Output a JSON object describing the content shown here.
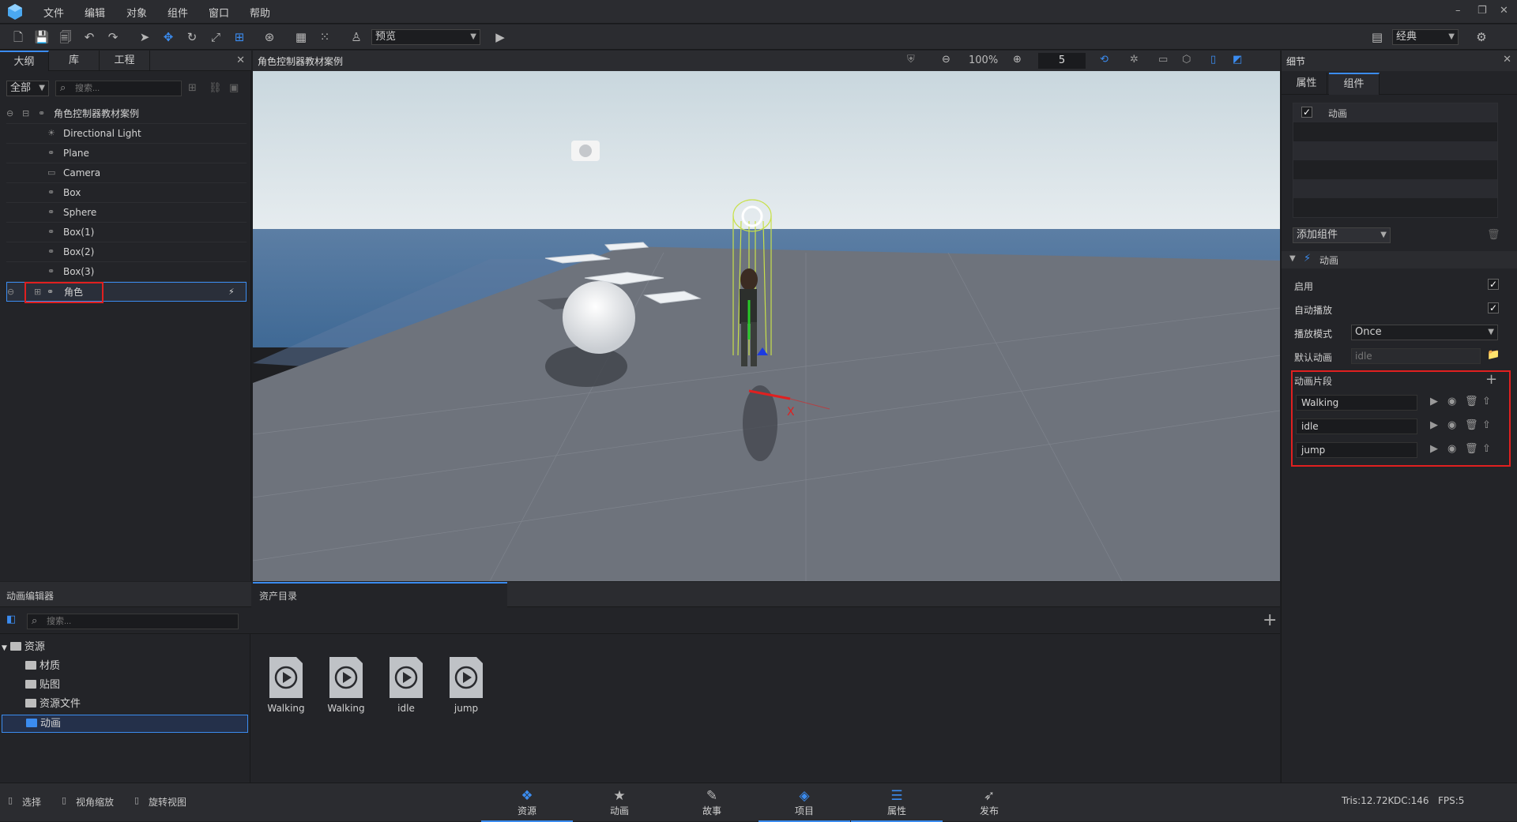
{
  "menu": [
    "文件",
    "编辑",
    "对象",
    "组件",
    "窗口",
    "帮助"
  ],
  "toolbar": {
    "preview_label": "预览",
    "layout_label": "经典"
  },
  "left": {
    "tabs": [
      "大纲",
      "库",
      "工程"
    ],
    "filter": "全部",
    "search_placeholder": "搜索...",
    "tree": [
      {
        "label": "角色控制器教材案例"
      },
      {
        "label": "Directional Light"
      },
      {
        "label": "Plane"
      },
      {
        "label": "Camera"
      },
      {
        "label": "Box"
      },
      {
        "label": "Sphere"
      },
      {
        "label": "Box(1)"
      },
      {
        "label": "Box(2)"
      },
      {
        "label": "Box(3)"
      },
      {
        "label": "角色"
      }
    ]
  },
  "viewport": {
    "title": "角色控制器教材案例",
    "zoom": "100%",
    "grid_value": "5",
    "axis_x": "X"
  },
  "right": {
    "title": "细节",
    "tabs": [
      "属性",
      "组件"
    ],
    "component_list": [
      {
        "label": "动画"
      }
    ],
    "add_component": "添加组件",
    "section": "动画",
    "enable_label": "启用",
    "autoplay_label": "自动播放",
    "playmode_label": "播放模式",
    "playmode_value": "Once",
    "default_anim_label": "默认动画",
    "default_anim_value": "idle",
    "clips_label": "动画片段",
    "clips": [
      "Walking",
      "idle",
      "jump"
    ]
  },
  "bottom": {
    "anim_editor": "动画编辑器",
    "asset_tab": "资产目录",
    "search_placeholder": "搜索...",
    "folders": [
      "资源",
      "材质",
      "贴图",
      "资源文件",
      "动画"
    ],
    "assets": [
      "Walking",
      "Walking",
      "idle",
      "jump"
    ]
  },
  "status": {
    "left": [
      "选择",
      "视角缩放",
      "旋转视图"
    ],
    "tabs": [
      "资源",
      "动画",
      "故事",
      "项目",
      "属性",
      "发布"
    ],
    "tris": "Tris:12.72K",
    "dc": "DC:146",
    "fps": "FPS:5"
  }
}
